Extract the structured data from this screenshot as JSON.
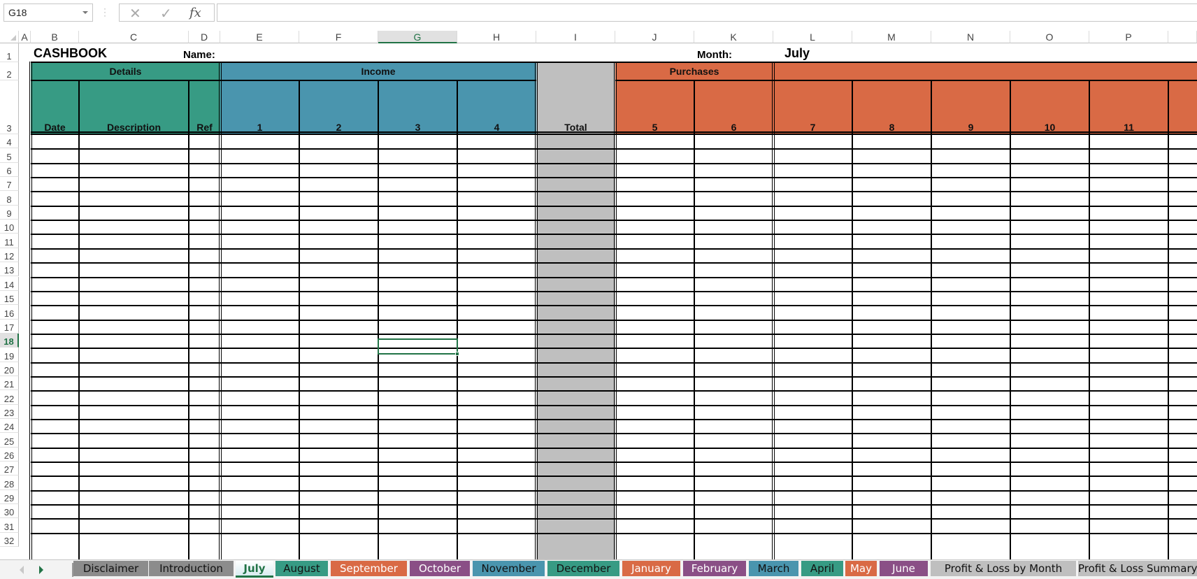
{
  "formula_bar": {
    "name_box": "G18",
    "cancel_icon": "✕",
    "enter_icon": "✓",
    "fx_label": "fx",
    "formula_value": ""
  },
  "columns": [
    {
      "label": "A"
    },
    {
      "label": "B"
    },
    {
      "label": "C"
    },
    {
      "label": "D"
    },
    {
      "label": "E"
    },
    {
      "label": "F"
    },
    {
      "label": "G",
      "selected": true
    },
    {
      "label": "H"
    },
    {
      "label": "I"
    },
    {
      "label": "J"
    },
    {
      "label": "K"
    },
    {
      "label": "L"
    },
    {
      "label": "M"
    },
    {
      "label": "N"
    },
    {
      "label": "O"
    },
    {
      "label": "P"
    },
    {
      "label": ""
    }
  ],
  "rows": [
    "1",
    "2",
    "3",
    "4",
    "5",
    "6",
    "7",
    "8",
    "9",
    "10",
    "11",
    "12",
    "13",
    "14",
    "15",
    "16",
    "17",
    "18",
    "19",
    "20",
    "21",
    "22",
    "23",
    "24",
    "25",
    "26",
    "27",
    "28",
    "29",
    "30",
    "31",
    "32"
  ],
  "selected_row": "18",
  "sheet": {
    "title": "CASHBOOK",
    "name_label": "Name:",
    "name_value": "",
    "month_label": "Month:",
    "month_value": "July",
    "groups": {
      "details": "Details",
      "income": "Income",
      "purchases": "Purchases",
      "expenses": ""
    },
    "headers": {
      "date": "Date",
      "description": "Description",
      "ref": "Ref",
      "income_cols": [
        "1",
        "2",
        "3",
        "4"
      ],
      "total": "Total",
      "purchase_cols": [
        "5",
        "6"
      ],
      "expense_cols": [
        "7",
        "8",
        "9",
        "10",
        "11",
        ""
      ]
    },
    "colors": {
      "details": "#379b84",
      "income": "#4a95ae",
      "total": "#bfbfbf",
      "purchases": "#d96a45"
    }
  },
  "tabs": [
    {
      "label": "Disclaimer",
      "bg": "#8c8c8c",
      "fg": "#111111"
    },
    {
      "label": "Introduction",
      "bg": "#8c8c8c",
      "fg": "#111111"
    },
    {
      "label": "July",
      "active": true
    },
    {
      "label": "August",
      "bg": "#379b84",
      "fg": "#111111"
    },
    {
      "label": "September",
      "bg": "#d96a45",
      "fg": "#ffffff"
    },
    {
      "label": "October",
      "bg": "#8a4f86",
      "fg": "#ffffff"
    },
    {
      "label": "November",
      "bg": "#4a95ae",
      "fg": "#111111"
    },
    {
      "label": "December",
      "bg": "#379b84",
      "fg": "#111111"
    },
    {
      "label": "January",
      "bg": "#d96a45",
      "fg": "#ffffff"
    },
    {
      "label": "February",
      "bg": "#8a4f86",
      "fg": "#ffffff"
    },
    {
      "label": "March",
      "bg": "#4a95ae",
      "fg": "#111111"
    },
    {
      "label": "April",
      "bg": "#379b84",
      "fg": "#111111"
    },
    {
      "label": "May",
      "bg": "#d96a45",
      "fg": "#ffffff"
    },
    {
      "label": "June",
      "bg": "#8a4f86",
      "fg": "#ffffff"
    },
    {
      "label": "Profit & Loss by Month",
      "bg": "#bfbfbf",
      "fg": "#111111"
    },
    {
      "label": "Profit & Loss Summary",
      "bg": "#bfbfbf",
      "fg": "#111111"
    }
  ]
}
